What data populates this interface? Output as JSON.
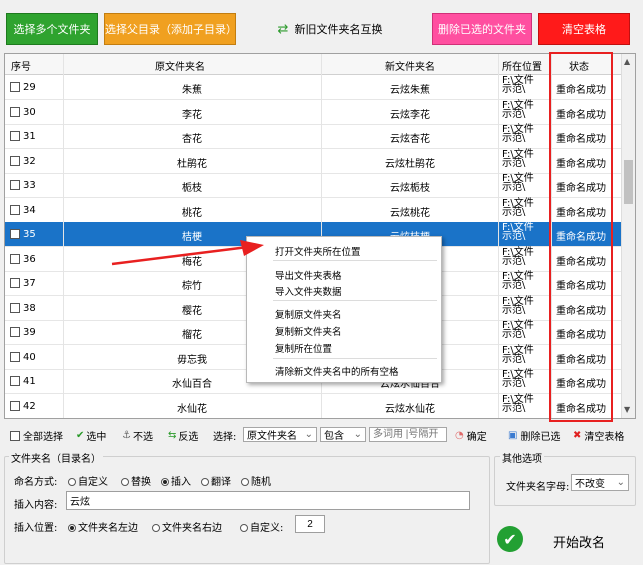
{
  "toolbar": {
    "select_multiple": "选择多个文件夹",
    "select_parent": "选择父目录（添加子目录）",
    "swap_names": "新旧文件夹名互换",
    "delete_selected": "删除已选的文件夹",
    "clear_table": "清空表格"
  },
  "table": {
    "headers": [
      "序号",
      "原文件夹名",
      "新文件夹名",
      "所在位置",
      "状态"
    ],
    "rows": [
      {
        "no": "29",
        "old": "朱蕉",
        "new": "云炫朱蕉",
        "loc1": "F:\\文件",
        "loc2": "示范\\",
        "status": "重命名成功"
      },
      {
        "no": "30",
        "old": "李花",
        "new": "云炫李花",
        "loc1": "F:\\文件",
        "loc2": "示范\\",
        "status": "重命名成功"
      },
      {
        "no": "31",
        "old": "杏花",
        "new": "云炫杏花",
        "loc1": "F:\\文件",
        "loc2": "示范\\",
        "status": "重命名成功"
      },
      {
        "no": "32",
        "old": "杜鹃花",
        "new": "云炫杜鹃花",
        "loc1": "F:\\文件",
        "loc2": "示范\\",
        "status": "重命名成功"
      },
      {
        "no": "33",
        "old": "栀枝",
        "new": "云炫栀枝",
        "loc1": "F:\\文件",
        "loc2": "示范\\",
        "status": "重命名成功"
      },
      {
        "no": "34",
        "old": "桃花",
        "new": "云炫桃花",
        "loc1": "F:\\文件",
        "loc2": "示范\\",
        "status": "重命名成功"
      },
      {
        "no": "35",
        "old": "桔梗",
        "new": "云炫桔梗",
        "loc1": "F:\\文件",
        "loc2": "示范\\",
        "status": "重命名成功"
      },
      {
        "no": "36",
        "old": "梅花",
        "new": "",
        "loc1": "F:\\文件",
        "loc2": "示范\\",
        "status": "重命名成功"
      },
      {
        "no": "37",
        "old": "棕竹",
        "new": "",
        "loc1": "F:\\文件",
        "loc2": "示范\\",
        "status": "重命名成功"
      },
      {
        "no": "38",
        "old": "樱花",
        "new": "",
        "loc1": "F:\\文件",
        "loc2": "示范\\",
        "status": "重命名成功"
      },
      {
        "no": "39",
        "old": "榴花",
        "new": "",
        "loc1": "F:\\文件",
        "loc2": "示范\\",
        "status": "重命名成功"
      },
      {
        "no": "40",
        "old": "毋忘我",
        "new": "",
        "loc1": "F:\\文件",
        "loc2": "示范\\",
        "status": "重命名成功"
      },
      {
        "no": "41",
        "old": "水仙百合",
        "new": "云炫水仙百合",
        "loc1": "F:\\文件",
        "loc2": "示范\\",
        "status": "重命名成功"
      },
      {
        "no": "42",
        "old": "水仙花",
        "new": "云炫水仙花",
        "loc1": "F:\\文件",
        "loc2": "示范\\",
        "status": "重命名成功"
      }
    ]
  },
  "context_menu": [
    "打开文件夹所在位置",
    "导出文件夹表格",
    "导入文件夹数据",
    "复制原文件夹名",
    "复制新文件夹名",
    "复制所在位置",
    "清除新文件夹名中的所有空格"
  ],
  "filterbar": {
    "select_all": "全部选择",
    "check": "选中",
    "uncheck": "不选",
    "invert": "反选",
    "select_label": "选择:",
    "field": "原文件夹名",
    "match": "包含",
    "keyword_placeholder": "多词用 |号隔开",
    "confirm": "确定",
    "delete_selected": "删除已选",
    "clear_table": "清空表格"
  },
  "settings": {
    "group_title": "文件夹名（目录名）",
    "mode_label": "命名方式:",
    "modes": [
      "自定义",
      "替换",
      "插入",
      "翻译",
      "随机"
    ],
    "content_label": "插入内容:",
    "content_value": "云炫",
    "pos_label": "插入位置:",
    "pos_left": "文件夹名左边",
    "pos_right": "文件夹名右边",
    "pos_custom": "自定义:",
    "pos_custom_value": "2"
  },
  "other": {
    "title": "其他选项",
    "case_label": "文件夹名字母:",
    "case_value": "不改变",
    "start": "开始改名"
  },
  "colors": {
    "selected_row": "#1a73c8",
    "highlight_box": "#e82020"
  }
}
